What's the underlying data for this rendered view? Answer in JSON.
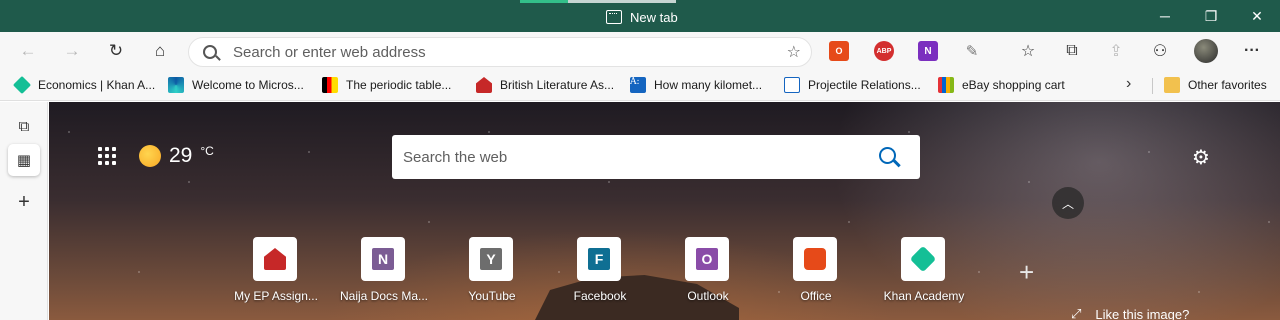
{
  "window": {
    "tab_title": "New tab",
    "controls": {
      "minimize": "─",
      "maximize": "❐",
      "close": "✕"
    }
  },
  "toolbar": {
    "back_icon": "←",
    "forward_icon": "→",
    "refresh_icon": "↻",
    "home_icon": "⌂",
    "address_placeholder": "Search or enter web address",
    "add_favorite_icon": "☆",
    "extensions": [
      {
        "name": "office-extension",
        "glyph": "O"
      },
      {
        "name": "adblock-plus-extension",
        "glyph": "ABP"
      },
      {
        "name": "onenote-extension",
        "glyph": "N"
      },
      {
        "name": "pen-extension",
        "glyph": "✎"
      }
    ],
    "favorites_icon": "☆",
    "collections_icon": "⧉",
    "share_icon": "⇪",
    "extensions_icon": "⚇",
    "menu_icon": "···"
  },
  "favorites": {
    "items": [
      {
        "label": "Economics | Khan A..."
      },
      {
        "label": "Welcome to Micros..."
      },
      {
        "label": "The periodic table..."
      },
      {
        "label": "British Literature As..."
      },
      {
        "label": "How many kilomet..."
      },
      {
        "label": "Projectile Relations..."
      },
      {
        "label": "eBay shopping cart"
      }
    ],
    "more_icon": "›",
    "other_favorites": "Other favorites",
    "az_glyph": "A:"
  },
  "sidebar": {
    "tab_icon": "⧉",
    "active_icon": "▦",
    "add_icon": "+"
  },
  "newtab": {
    "temperature": "29",
    "temperature_unit": "°C",
    "search_placeholder": "Search the web",
    "settings_icon": "⚙",
    "collapse_icon": "︿",
    "add_tile_icon": "+",
    "like_image_icon": "⤢",
    "like_image_text": "Like this image?",
    "tiles": [
      {
        "label": "My EP Assign...",
        "glyph": "",
        "color": "#c62828"
      },
      {
        "label": "Naija Docs Ma...",
        "glyph": "N",
        "color": "#7b5c94"
      },
      {
        "label": "YouTube",
        "glyph": "Y",
        "color": "#6d6d6d"
      },
      {
        "label": "Facebook",
        "glyph": "F",
        "color": "#0f6f93"
      },
      {
        "label": "Outlook",
        "glyph": "O",
        "color": "#8a4ca8"
      },
      {
        "label": "Office",
        "glyph": "",
        "color": "#e64a19"
      },
      {
        "label": "Khan Academy",
        "glyph": "",
        "color": "#14bf96"
      }
    ]
  }
}
